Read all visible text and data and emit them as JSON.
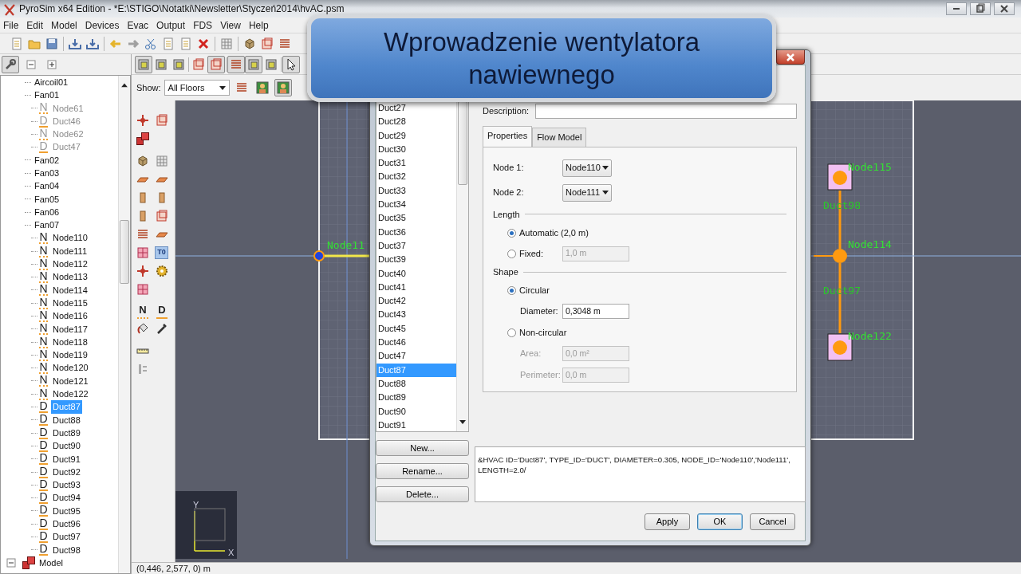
{
  "window": {
    "title": "PyroSim x64 Edition - *E:\\STIGO\\Notatki\\Newsletter\\Styczeń2014\\hvAC.psm"
  },
  "menu": [
    "File",
    "Edit",
    "Model",
    "Devices",
    "Evac",
    "Output",
    "FDS",
    "View",
    "Help"
  ],
  "caption": "Wprowadzenie wentylatora nawiewnego",
  "tree": {
    "items": [
      {
        "label": "Aircoil01"
      },
      {
        "label": "Fan01",
        "children": [
          {
            "label": "Node61",
            "icon": "N",
            "dimmed": true,
            "selected": false
          },
          {
            "label": "Duct46",
            "icon": "D",
            "dimmed": true,
            "selected": false
          },
          {
            "label": "Node62",
            "icon": "N",
            "dimmed": true,
            "selected": false
          },
          {
            "label": "Duct47",
            "icon": "D",
            "dimmed": true,
            "selected": false
          }
        ]
      },
      {
        "label": "Fan02"
      },
      {
        "label": "Fan03"
      },
      {
        "label": "Fan04"
      },
      {
        "label": "Fan05"
      },
      {
        "label": "Fan06"
      },
      {
        "label": "Fan07",
        "children": [
          {
            "label": "Node110",
            "icon": "N",
            "dimmed": false,
            "selected": false
          },
          {
            "label": "Node111",
            "icon": "N",
            "dimmed": false,
            "selected": false
          },
          {
            "label": "Node112",
            "icon": "N",
            "dimmed": false,
            "selected": false
          },
          {
            "label": "Node113",
            "icon": "N",
            "dimmed": false,
            "selected": false
          },
          {
            "label": "Node114",
            "icon": "N",
            "dimmed": false,
            "selected": false
          },
          {
            "label": "Node115",
            "icon": "N",
            "dimmed": false,
            "selected": false
          },
          {
            "label": "Node116",
            "icon": "N",
            "dimmed": false,
            "selected": false
          },
          {
            "label": "Node117",
            "icon": "N",
            "dimmed": false,
            "selected": false
          },
          {
            "label": "Node118",
            "icon": "N",
            "dimmed": false,
            "selected": false
          },
          {
            "label": "Node119",
            "icon": "N",
            "dimmed": false,
            "selected": false
          },
          {
            "label": "Node120",
            "icon": "N",
            "dimmed": false,
            "selected": false
          },
          {
            "label": "Node121",
            "icon": "N",
            "dimmed": false,
            "selected": false
          },
          {
            "label": "Node122",
            "icon": "N",
            "dimmed": false,
            "selected": false
          },
          {
            "label": "Duct87",
            "icon": "D",
            "dimmed": false,
            "selected": true
          },
          {
            "label": "Duct88",
            "icon": "D",
            "dimmed": false,
            "selected": false
          },
          {
            "label": "Duct89",
            "icon": "D",
            "dimmed": false,
            "selected": false
          },
          {
            "label": "Duct90",
            "icon": "D",
            "dimmed": false,
            "selected": false
          },
          {
            "label": "Duct91",
            "icon": "D",
            "dimmed": false,
            "selected": false
          },
          {
            "label": "Duct92",
            "icon": "D",
            "dimmed": false,
            "selected": false
          },
          {
            "label": "Duct93",
            "icon": "D",
            "dimmed": false,
            "selected": false
          },
          {
            "label": "Duct94",
            "icon": "D",
            "dimmed": false,
            "selected": false
          },
          {
            "label": "Duct95",
            "icon": "D",
            "dimmed": false,
            "selected": false
          },
          {
            "label": "Duct96",
            "icon": "D",
            "dimmed": false,
            "selected": false
          },
          {
            "label": "Duct97",
            "icon": "D",
            "dimmed": false,
            "selected": false
          },
          {
            "label": "Duct98",
            "icon": "D",
            "dimmed": false,
            "selected": false
          }
        ]
      }
    ],
    "root": {
      "label": "Model",
      "expanded": true
    }
  },
  "view": {
    "show_label": "Show:",
    "floor": "All Floors",
    "letter_tools": [
      "T0",
      "N",
      "D"
    ]
  },
  "canvas": {
    "labels": [
      {
        "text": "Node11",
        "kind": "node"
      },
      {
        "text": "Node115",
        "kind": "node"
      },
      {
        "text": "Duct98",
        "kind": "duct"
      },
      {
        "text": "Node114",
        "kind": "node"
      },
      {
        "text": "Duct97",
        "kind": "duct"
      },
      {
        "text": "Node122",
        "kind": "node"
      }
    ],
    "axes": [
      "Y",
      "X"
    ]
  },
  "status_bar": "(0,446, 2,577, 0) m",
  "dialog": {
    "list": [
      {
        "label": "Duct27",
        "selected": false
      },
      {
        "label": "Duct28",
        "selected": false
      },
      {
        "label": "Duct29",
        "selected": false
      },
      {
        "label": "Duct30",
        "selected": false
      },
      {
        "label": "Duct31",
        "selected": false
      },
      {
        "label": "Duct32",
        "selected": false
      },
      {
        "label": "Duct33",
        "selected": false
      },
      {
        "label": "Duct34",
        "selected": false
      },
      {
        "label": "Duct35",
        "selected": false
      },
      {
        "label": "Duct36",
        "selected": false
      },
      {
        "label": "Duct37",
        "selected": false
      },
      {
        "label": "Duct39",
        "selected": false
      },
      {
        "label": "Duct40",
        "selected": false
      },
      {
        "label": "Duct41",
        "selected": false
      },
      {
        "label": "Duct42",
        "selected": false
      },
      {
        "label": "Duct43",
        "selected": false
      },
      {
        "label": "Duct45",
        "selected": false
      },
      {
        "label": "Duct46",
        "selected": false
      },
      {
        "label": "Duct47",
        "selected": false
      },
      {
        "label": "Duct87",
        "selected": true
      },
      {
        "label": "Duct88",
        "selected": false
      },
      {
        "label": "Duct89",
        "selected": false
      },
      {
        "label": "Duct90",
        "selected": false
      },
      {
        "label": "Duct91",
        "selected": false
      }
    ],
    "buttons": [
      "New...",
      "Rename...",
      "Delete..."
    ],
    "description_label": "Description:",
    "tabs": [
      {
        "label": "Properties",
        "selected": true
      },
      {
        "label": "Flow Model",
        "selected": false
      }
    ],
    "nodes": [
      {
        "label": "Node 1:",
        "value": "Node110"
      },
      {
        "label": "Node 2:",
        "value": "Node111"
      }
    ],
    "length": {
      "title": "Length",
      "options": [
        {
          "label": "Automatic (2,0 m)",
          "selected": true
        },
        {
          "label": "Fixed:",
          "selected": false,
          "fields": [
            {
              "value": "1,0 m"
            }
          ]
        }
      ]
    },
    "shape": {
      "title": "Shape",
      "options": [
        {
          "label": "Circular",
          "selected": true,
          "fields": [
            {
              "label": "Diameter:",
              "value": "0,3048 m"
            }
          ]
        },
        {
          "label": "Non-circular",
          "selected": false,
          "fields": [
            {
              "label": "Area:",
              "value": "0,0 m²"
            },
            {
              "label": "Perimeter:",
              "value": "0,0 m"
            }
          ]
        }
      ]
    },
    "fds": "&HVAC ID='Duct87', TYPE_ID='DUCT', DIAMETER=0.305, NODE_ID='Node110','Node111', LENGTH=2.0/",
    "actions": [
      {
        "label": "Apply",
        "default": false
      },
      {
        "label": "OK",
        "default": true
      },
      {
        "label": "Cancel",
        "default": false
      }
    ]
  }
}
